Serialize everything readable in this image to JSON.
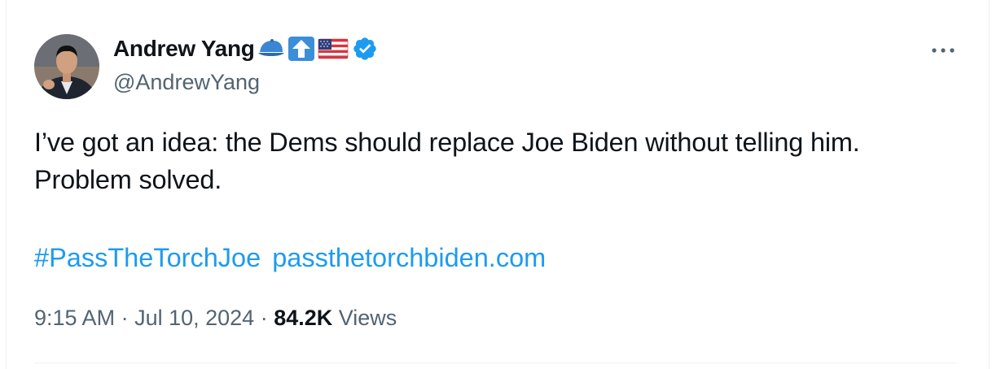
{
  "author": {
    "display_name": "Andrew Yang",
    "handle": "@AndrewYang",
    "name_emojis": [
      "blue-cap-icon",
      "up-arrow-icon",
      "us-flag-icon"
    ],
    "verified_icon": "verified-badge-icon"
  },
  "tweet": {
    "text_line1": "I’ve got an idea:  the Dems should replace Joe Biden without telling him.",
    "text_line2": "Problem solved.",
    "hashtag": "#PassTheTorchJoe",
    "url": "passthetorchbiden.com"
  },
  "meta": {
    "time": "9:15 AM",
    "separator1": " · ",
    "date": "Jul 10, 2024",
    "separator2": " · ",
    "views_count": "84.2K",
    "views_label": " Views"
  },
  "colors": {
    "link": "#1d9bf0",
    "secondary_text": "#536471",
    "primary_text": "#0f1419",
    "verified": "#1d9bf0"
  },
  "more_icon": "more-horizontal-icon"
}
